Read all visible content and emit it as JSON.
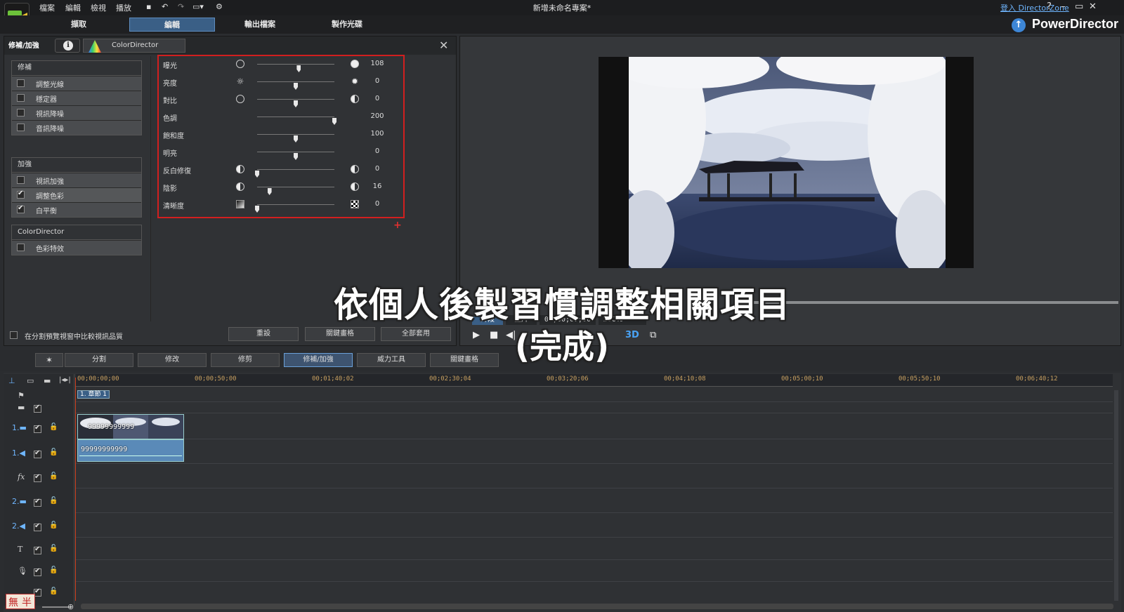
{
  "menu": [
    "檔案",
    "編輯",
    "檢視",
    "播放"
  ],
  "project_title": "新增未命名專案*",
  "login_link": "登入 DirectorZone",
  "window_buttons": [
    "?",
    "–",
    "▭",
    "✕"
  ],
  "mode_tabs": [
    "擷取",
    "編輯",
    "輸出檔案",
    "製作光碟"
  ],
  "brand": "PowerDirector",
  "panel": {
    "tab_label": "修補/加強",
    "cd_tab": "ColorDirector",
    "groups": [
      {
        "header": "修補",
        "items": [
          {
            "label": "調整光線",
            "checked": false
          },
          {
            "label": "穩定器",
            "checked": false
          },
          {
            "label": "視訊降噪",
            "checked": false
          },
          {
            "label": "音訊降噪",
            "checked": false
          }
        ]
      },
      {
        "header": "加強",
        "items": [
          {
            "label": "視訊加強",
            "checked": false
          },
          {
            "label": "調整色彩",
            "checked": true
          },
          {
            "label": "白平衡",
            "checked": true
          }
        ]
      },
      {
        "header": "ColorDirector",
        "items": [
          {
            "label": "色彩特效",
            "checked": false
          }
        ]
      }
    ],
    "adjustments": [
      {
        "label": "曝光",
        "value": "108",
        "level": 0.54
      },
      {
        "label": "亮度",
        "value": "0",
        "level": 0.5
      },
      {
        "label": "對比",
        "value": "0",
        "level": 0.5
      },
      {
        "label": "色調",
        "value": "200",
        "level": 1.0
      },
      {
        "label": "飽和度",
        "value": "100",
        "level": 0.5
      },
      {
        "label": "明亮",
        "value": "0",
        "level": 0.5
      },
      {
        "label": "反白修復",
        "value": "0",
        "level": 0.0
      },
      {
        "label": "陰影",
        "value": "16",
        "level": 0.16
      },
      {
        "label": "清晰度",
        "value": "0",
        "level": 0.0
      }
    ],
    "compare_label": "在分割預覽視窗中比較視訊品質",
    "buttons": [
      "重設",
      "關鍵畫格",
      "全部套用"
    ]
  },
  "preview": {
    "mode_clip": "片段",
    "mode_full": "全片",
    "timecode": "00;00;00;00",
    "zoom": "100%",
    "badge_3d": "3D"
  },
  "function_bar": [
    "分割",
    "修改",
    "修剪",
    "修補/加強",
    "威力工具",
    "關鍵畫格"
  ],
  "timeline": {
    "ticks": [
      "00;00;00;00",
      "00;00;50;00",
      "00;01;40;02",
      "00;02;30;04",
      "00;03;20;06",
      "00;04;10;08",
      "00;05;00;10",
      "00;05;50;10",
      "00;06;40;12"
    ],
    "chapter": "1. 章節 1",
    "clip_video_name": "99999999999",
    "clip_audio_name": "99999999999",
    "track_labels": [
      "1.",
      "1.",
      "fx",
      "2.",
      "2.",
      "T",
      "",
      ""
    ]
  },
  "caption_line1": "依個人後製習慣調整相關項目",
  "caption_line2": "(完成)",
  "stamp_text": [
    "無",
    "半"
  ],
  "colors": {
    "accent": "#3a5f86",
    "highlight_box": "#d21f1f",
    "tick_color": "#c8a060"
  }
}
